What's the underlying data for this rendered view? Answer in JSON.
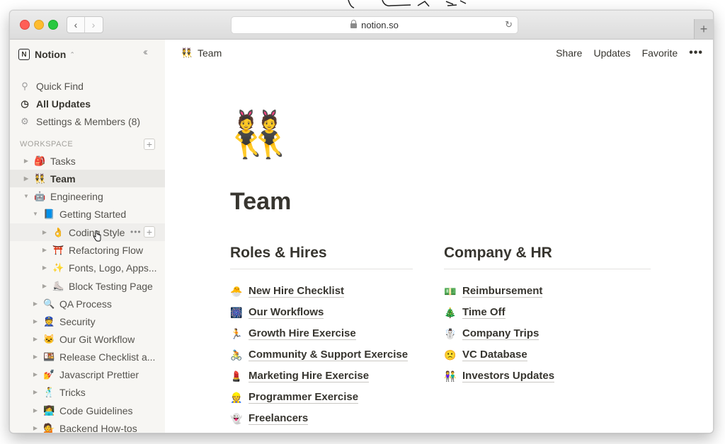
{
  "browser": {
    "url": "notion.so"
  },
  "sidebar": {
    "workspace_name": "Notion",
    "quick_find": "Quick Find",
    "all_updates": "All Updates",
    "settings_members": "Settings & Members (8)",
    "section_label": "WORKSPACE",
    "tree": [
      {
        "emoji": "🎒",
        "label": "Tasks",
        "icon": "backpack-icon"
      },
      {
        "emoji": "👯",
        "label": "Team",
        "icon": "dancers-icon"
      },
      {
        "emoji": "🤖",
        "label": "Engineering",
        "icon": "robot-icon"
      },
      {
        "emoji": "📘",
        "label": "Getting Started",
        "icon": "blue-book-icon"
      },
      {
        "emoji": "👌",
        "label": "Coding Style",
        "icon": "ok-hand-icon"
      },
      {
        "emoji": "⛩️",
        "label": "Refactoring Flow",
        "icon": "shrine-gate-icon"
      },
      {
        "emoji": "✨",
        "label": "Fonts, Logo, Apps...",
        "icon": "sparkles-icon"
      },
      {
        "emoji": "⛸️",
        "label": "Block Testing Page",
        "icon": "ice-skate-icon"
      },
      {
        "emoji": "🔍",
        "label": "QA Process",
        "icon": "magnifier-icon"
      },
      {
        "emoji": "👮",
        "label": "Security",
        "icon": "police-officer-icon"
      },
      {
        "emoji": "🐱",
        "label": "Our Git Workflow",
        "icon": "cat-icon"
      },
      {
        "emoji": "🍱",
        "label": "Release Checklist a...",
        "icon": "bento-icon"
      },
      {
        "emoji": "💅",
        "label": "Javascript Prettier",
        "icon": "nail-polish-icon"
      },
      {
        "emoji": "🕺",
        "label": "Tricks",
        "icon": "dancer-icon"
      },
      {
        "emoji": "👩‍💻",
        "label": "Code Guidelines",
        "icon": "technologist-icon"
      },
      {
        "emoji": "💁",
        "label": "Backend How-tos",
        "icon": "info-person-icon"
      }
    ]
  },
  "topbar": {
    "emoji": "👯",
    "title": "Team",
    "share": "Share",
    "updates": "Updates",
    "favorite": "Favorite",
    "more": "•••"
  },
  "page": {
    "icon": "👯",
    "title": "Team",
    "left_heading": "Roles & Hires",
    "left_links": [
      {
        "emoji": "🐣",
        "label": "New Hire Checklist"
      },
      {
        "emoji": "🎆",
        "label": "Our Workflows"
      },
      {
        "emoji": "🏃",
        "label": "Growth Hire Exercise"
      },
      {
        "emoji": "🚴",
        "label": "Community & Support Exercise"
      },
      {
        "emoji": "💄",
        "label": "Marketing Hire Exercise"
      },
      {
        "emoji": "👷",
        "label": "Programmer Exercise"
      },
      {
        "emoji": "👻",
        "label": "Freelancers"
      }
    ],
    "right_heading": "Company & HR",
    "right_links": [
      {
        "emoji": "💵",
        "label": "Reimbursement"
      },
      {
        "emoji": "🎄",
        "label": "Time Off"
      },
      {
        "emoji": "☃️",
        "label": "Company Trips"
      },
      {
        "emoji": "🙁",
        "label": "VC Database"
      },
      {
        "emoji": "👫",
        "label": "Investors Updates"
      }
    ]
  }
}
